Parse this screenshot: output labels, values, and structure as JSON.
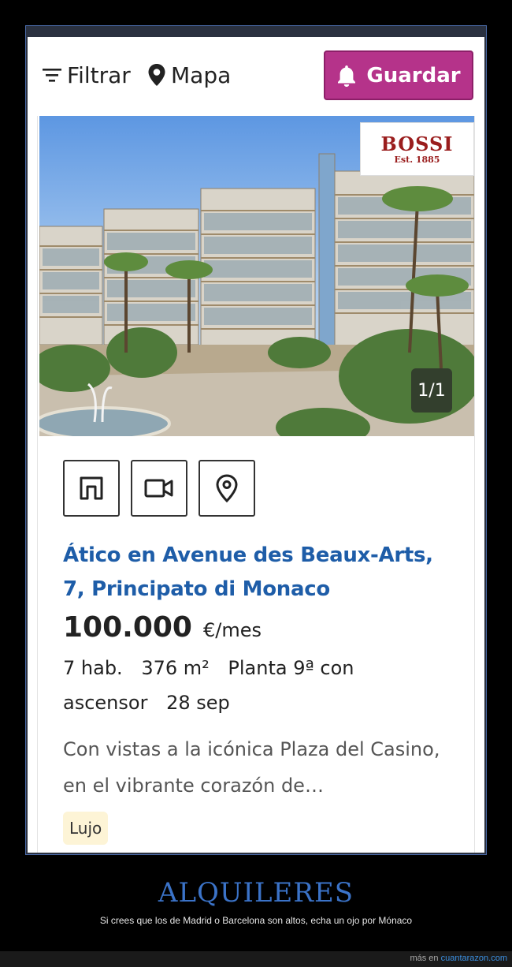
{
  "toolbar": {
    "filter_label": "Filtrar",
    "map_label": "Mapa",
    "save_label": "Guardar"
  },
  "listing": {
    "photo": {
      "agency_logo_name": "BOSSI",
      "agency_logo_est": "Est. 1885",
      "counter": "1/1"
    },
    "action_icons": [
      "floor-plan-icon",
      "video-icon",
      "location-pin-icon"
    ],
    "title": "Ático en Avenue des Beaux-Arts, 7, Principato di Monaco",
    "price_amount": "100.000",
    "price_unit": "€/mes",
    "details": [
      "7 hab.",
      "376 m²",
      "Planta 9ª con ascensor",
      "28 sep"
    ],
    "description": "Con vistas a la icónica Plaza del Casino, en el vibrante corazón de…",
    "tag": "Lujo"
  },
  "caption": {
    "title": "ALQUILERES",
    "subtitle": "Si crees que los de Madrid o Barcelona son altos, echa un ojo por Mónaco"
  },
  "footer": {
    "prefix": "más en",
    "site": "cuantarazon.com"
  },
  "colors": {
    "save_button": "#b5338a",
    "title_link": "#1e5da8",
    "caption_title": "#3b73c8",
    "tag_bg": "#fdf4d6"
  }
}
